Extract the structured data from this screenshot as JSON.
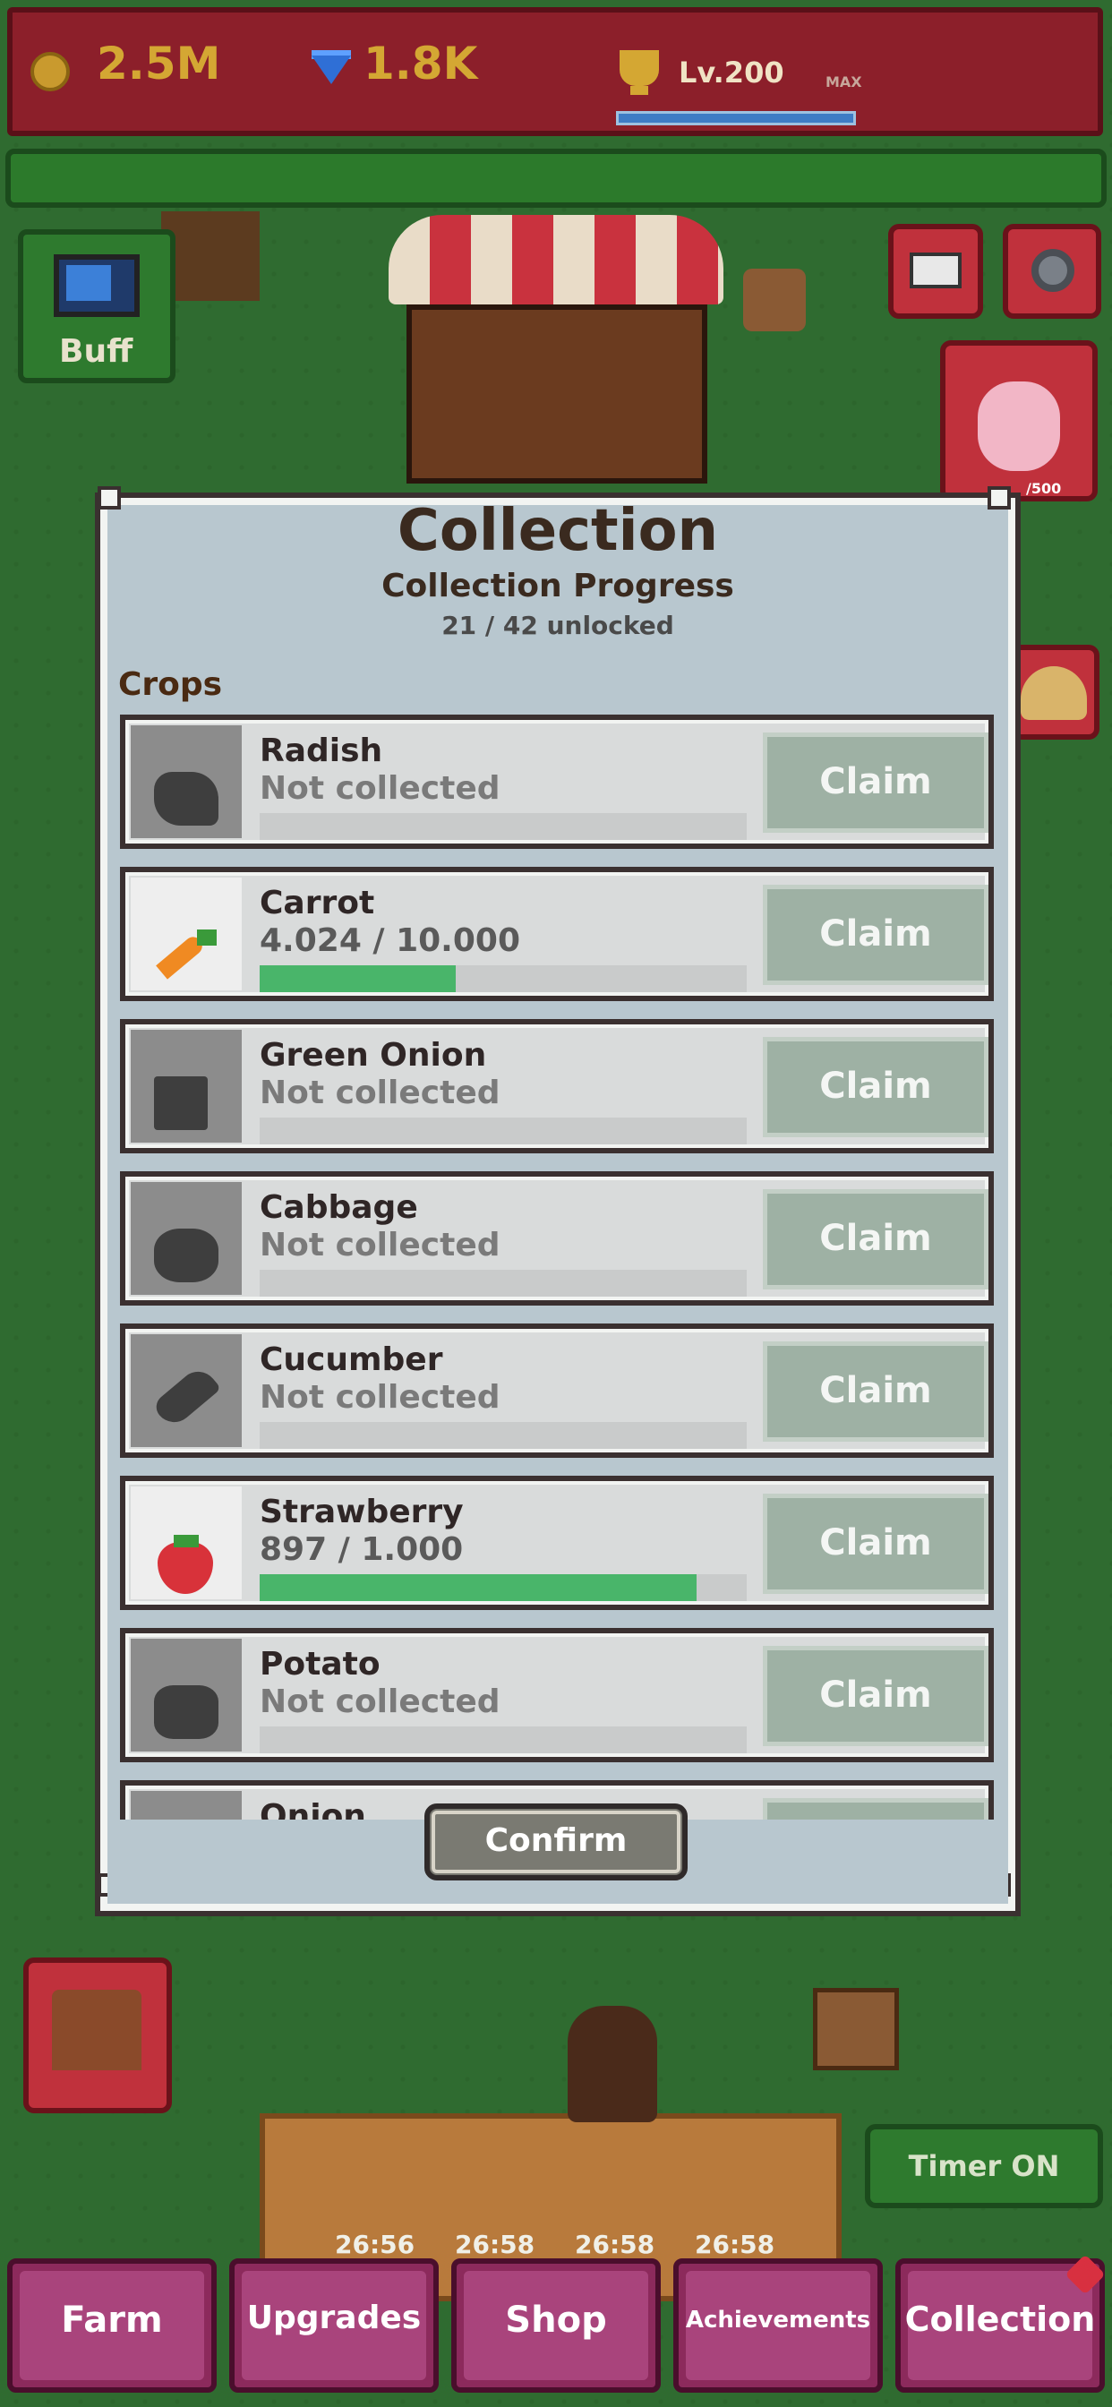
{
  "top_bar": {
    "gold": "2.5M",
    "gems": "1.8K",
    "level": "Lv.200",
    "max_label": "MAX",
    "xp_progress": 1.0
  },
  "hud": {
    "buff_label": "Buff",
    "piggy_count": "/500",
    "timer_label": "Timer ON",
    "timers": [
      "26:56",
      "26:58",
      "26:58",
      "26:58"
    ]
  },
  "dialog": {
    "title": "Collection",
    "subtitle": "Collection Progress",
    "unlocked": "21 / 42 unlocked",
    "section": "Crops",
    "confirm_label": "Confirm",
    "items": [
      {
        "name": "Radish",
        "status": "Not collected",
        "progress": 0,
        "claim": "Claim"
      },
      {
        "name": "Carrot",
        "status": "4.024 / 10.000",
        "progress": 0.4024,
        "claim": "Claim"
      },
      {
        "name": "Green Onion",
        "status": "Not collected",
        "progress": 0,
        "claim": "Claim"
      },
      {
        "name": "Cabbage",
        "status": "Not collected",
        "progress": 0,
        "claim": "Claim"
      },
      {
        "name": "Cucumber",
        "status": "Not collected",
        "progress": 0,
        "claim": "Claim"
      },
      {
        "name": "Strawberry",
        "status": "897 / 1.000",
        "progress": 0.897,
        "claim": "Claim"
      },
      {
        "name": "Potato",
        "status": "Not collected",
        "progress": 0,
        "claim": "Claim"
      },
      {
        "name": "Onion",
        "status": "",
        "progress": 0,
        "claim": ""
      }
    ]
  },
  "nav": {
    "farm": "Farm",
    "upgrades": "Upgrades",
    "shop": "Shop",
    "achievements": "Achievements",
    "collection": "Collection"
  },
  "colors": {
    "progress_fill": "#49b56a",
    "claim_bg": "#9eb1a4",
    "dialog_bg": "#b8c7cf",
    "nav_bg": "#a9447c"
  }
}
